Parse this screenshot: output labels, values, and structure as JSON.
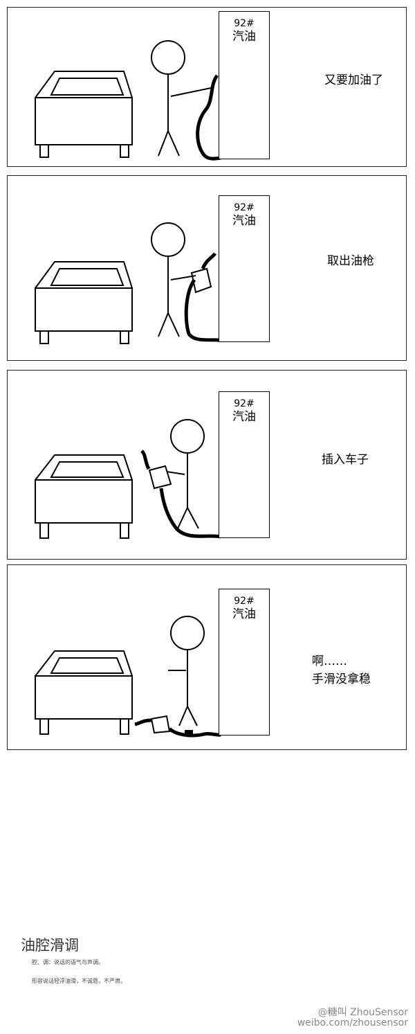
{
  "pump": {
    "grade": "92#",
    "fuel": "汽油"
  },
  "panels": [
    {
      "caption_lines": [
        "又要加油了"
      ]
    },
    {
      "caption_lines": [
        "取出油枪"
      ]
    },
    {
      "caption_lines": [
        "插入车子"
      ]
    },
    {
      "caption_lines": [
        "啊……",
        "手滑没拿稳"
      ]
    }
  ],
  "idiom": {
    "title": "油腔滑调",
    "note_1": "腔、调：说话的语气与声调。",
    "note_2": "形容说话轻浮油滑，不诚恳，不严肃。"
  },
  "watermark": {
    "handle": "@糖叫 ZhouSensor",
    "url": "weibo.com/zhousensor"
  }
}
